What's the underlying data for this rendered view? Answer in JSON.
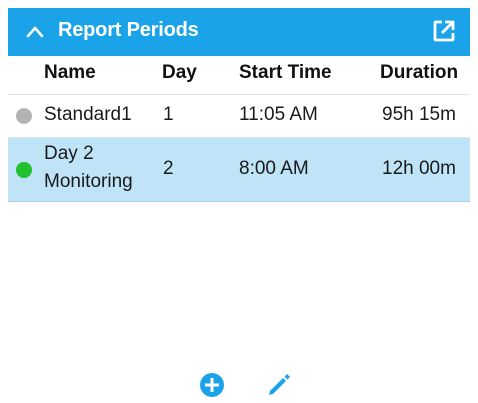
{
  "header": {
    "title": "Report Periods",
    "collapse_icon": "chevron-up-icon",
    "popout_icon": "open-external-icon",
    "background_color": "#1aa3e8"
  },
  "table": {
    "columns": [
      "Name",
      "Day",
      "Start Time",
      "Duration"
    ],
    "rows": [
      {
        "status_color": "#b3b3b3",
        "name": "Standard1",
        "day": "1",
        "start_time": "11:05 AM",
        "duration": "95h 15m",
        "selected": false
      },
      {
        "status_color": "#22c02e",
        "name_line1": "Day 2",
        "name_line2": "Monitoring",
        "day": "2",
        "start_time": "8:00 AM",
        "duration": "12h 00m",
        "selected": true
      }
    ]
  },
  "footer": {
    "add_icon": "add-circle-icon",
    "edit_icon": "pencil-icon",
    "icon_color": "#1aa3e8"
  }
}
